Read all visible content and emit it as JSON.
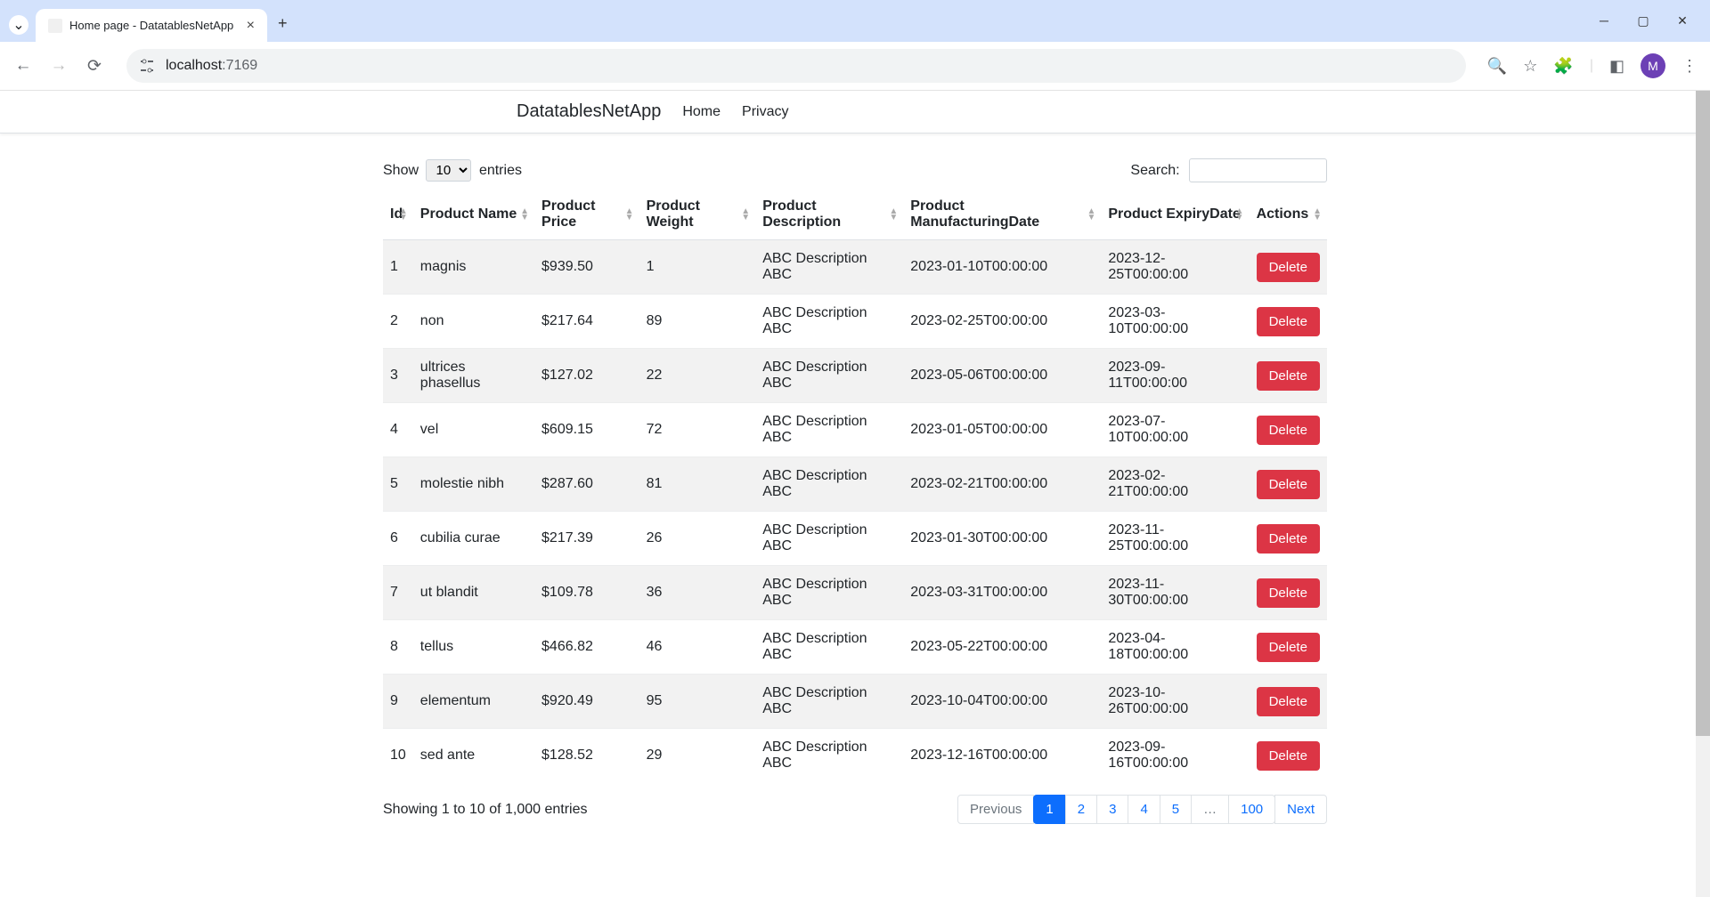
{
  "browser": {
    "tab_title": "Home page - DatatablesNetApp",
    "url_host": "localhost",
    "url_port": ":7169",
    "avatar_letter": "M"
  },
  "navbar": {
    "brand": "DatatablesNetApp",
    "links": [
      "Home",
      "Privacy"
    ]
  },
  "datatable": {
    "length_prefix": "Show",
    "length_value": "10",
    "length_suffix": "entries",
    "search_label": "Search:",
    "columns": [
      "Id",
      "Product Name",
      "Product Price",
      "Product Weight",
      "Product Description",
      "Product ManufacturingDate",
      "Product ExpiryDate",
      "Actions"
    ],
    "rows": [
      {
        "id": "1",
        "name": "magnis",
        "price": "$939.50",
        "weight": "1",
        "desc": "ABC Description ABC",
        "mfg": "2023-01-10T00:00:00",
        "exp": "2023-12-25T00:00:00"
      },
      {
        "id": "2",
        "name": "non",
        "price": "$217.64",
        "weight": "89",
        "desc": "ABC Description ABC",
        "mfg": "2023-02-25T00:00:00",
        "exp": "2023-03-10T00:00:00"
      },
      {
        "id": "3",
        "name": "ultrices phasellus",
        "price": "$127.02",
        "weight": "22",
        "desc": "ABC Description ABC",
        "mfg": "2023-05-06T00:00:00",
        "exp": "2023-09-11T00:00:00"
      },
      {
        "id": "4",
        "name": "vel",
        "price": "$609.15",
        "weight": "72",
        "desc": "ABC Description ABC",
        "mfg": "2023-01-05T00:00:00",
        "exp": "2023-07-10T00:00:00"
      },
      {
        "id": "5",
        "name": "molestie nibh",
        "price": "$287.60",
        "weight": "81",
        "desc": "ABC Description ABC",
        "mfg": "2023-02-21T00:00:00",
        "exp": "2023-02-21T00:00:00"
      },
      {
        "id": "6",
        "name": "cubilia curae",
        "price": "$217.39",
        "weight": "26",
        "desc": "ABC Description ABC",
        "mfg": "2023-01-30T00:00:00",
        "exp": "2023-11-25T00:00:00"
      },
      {
        "id": "7",
        "name": "ut blandit",
        "price": "$109.78",
        "weight": "36",
        "desc": "ABC Description ABC",
        "mfg": "2023-03-31T00:00:00",
        "exp": "2023-11-30T00:00:00"
      },
      {
        "id": "8",
        "name": "tellus",
        "price": "$466.82",
        "weight": "46",
        "desc": "ABC Description ABC",
        "mfg": "2023-05-22T00:00:00",
        "exp": "2023-04-18T00:00:00"
      },
      {
        "id": "9",
        "name": "elementum",
        "price": "$920.49",
        "weight": "95",
        "desc": "ABC Description ABC",
        "mfg": "2023-10-04T00:00:00",
        "exp": "2023-10-26T00:00:00"
      },
      {
        "id": "10",
        "name": "sed ante",
        "price": "$128.52",
        "weight": "29",
        "desc": "ABC Description ABC",
        "mfg": "2023-12-16T00:00:00",
        "exp": "2023-09-16T00:00:00"
      }
    ],
    "delete_label": "Delete",
    "info_text": "Showing 1 to 10 of 1,000 entries",
    "pagination": {
      "previous": "Previous",
      "pages": [
        "1",
        "2",
        "3",
        "4",
        "5",
        "…",
        "100"
      ],
      "active_index": 0,
      "next": "Next"
    }
  }
}
